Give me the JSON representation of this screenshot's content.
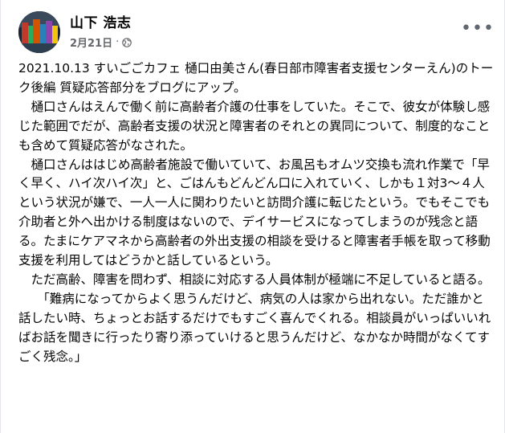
{
  "post": {
    "author": "山下 浩志",
    "date": "2月21日",
    "separator": "·",
    "privacy_icon": "globe-icon",
    "more_icon": "more-horizontal-icon",
    "more_label": "•••",
    "paragraphs": [
      "2021.10.13 すいごごカフェ 樋口由美さん(春日部市障害者支援センターえん)のトーク後編 質疑応答部分をブログにアップ。",
      "樋口さんはえんで働く前に高齢者介護の仕事をしていた。そこで、彼女が体験し感じた範囲でだが、高齢者支援の状況と障害者のそれとの異同について、制度的なことも含めて質疑応答がなされた。",
      "樋口さんははじめ高齢者施設で働いていて、お風呂もオムツ交換も流れ作業で「早く早く、ハイ次ハイ次」と、ごはんもどんどん口に入れていく、しかも１対3～４人という状況が嫌で、一人一人に関わりたいと訪問介護に転じたという。でもそこでも介助者と外へ出かける制度はないので、デイサービスになってしまうのが残念と語る。たまにケアマネから高齢者の外出支援の相談を受けると障害者手帳を取って移動支援を利用してはどうかと話しているという。",
      "ただ高齢、障害を問わず、相談に対応する人員体制が極端に不足していると語る。",
      "「難病になってからよく思うんだけど、病気の人は家から出れない。ただ誰かと話したい時、ちょっとお話するだけでもすごく喜んでくれる。相談員がいっぱいいればお話を聞きに行ったり寄り添っていけると思うんだけど、なかなか時間がなくてすごく残念。」"
    ]
  }
}
